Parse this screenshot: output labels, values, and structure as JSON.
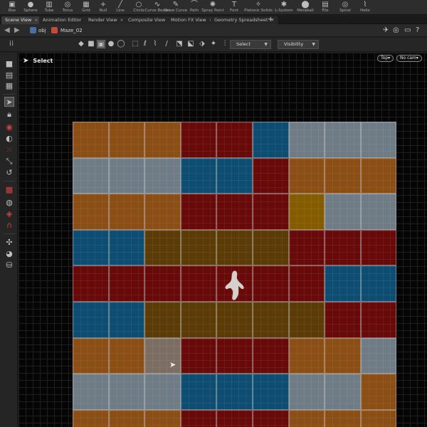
{
  "shelf": {
    "tools": [
      {
        "label": "Box",
        "icon": "box-icon"
      },
      {
        "label": "Sphere",
        "icon": "sphere-icon"
      },
      {
        "label": "Tube",
        "icon": "tube-icon"
      },
      {
        "label": "Torus",
        "icon": "torus-icon"
      },
      {
        "label": "Grid",
        "icon": "grid-icon"
      },
      {
        "label": "Null",
        "icon": "null-icon"
      },
      {
        "label": "Line",
        "icon": "line-icon"
      },
      {
        "label": "Circle",
        "icon": "circle-icon"
      },
      {
        "label": "Curve Bezier",
        "icon": "curve-bezier-icon"
      },
      {
        "label": "Draw Curve",
        "icon": "draw-curve-icon"
      },
      {
        "label": "Path",
        "icon": "path-icon"
      },
      {
        "label": "Spray Paint",
        "icon": "spray-paint-icon"
      },
      {
        "label": "Font",
        "icon": "font-icon"
      },
      {
        "label": "Platonic Solids",
        "icon": "platonic-solids-icon"
      },
      {
        "label": "L-System",
        "icon": "l-system-icon"
      },
      {
        "label": "Metaball",
        "icon": "metaball-icon"
      },
      {
        "label": "File",
        "icon": "file-icon"
      },
      {
        "label": "Spiral",
        "icon": "spiral-icon"
      },
      {
        "label": "Helix",
        "icon": "helix-icon"
      }
    ]
  },
  "tabs": [
    {
      "label": "Scene View",
      "active": true
    },
    {
      "label": "Animation Editor"
    },
    {
      "label": "Render View"
    },
    {
      "label": "Composite View"
    },
    {
      "label": "Motion FX View"
    },
    {
      "label": "Geometry Spreadsheet"
    }
  ],
  "tab_close": "×",
  "tab_add": "+",
  "path": {
    "root": "obj",
    "node": "Maze_02"
  },
  "toolbar": {
    "select_mode": "Select",
    "visibility": "Visibility"
  },
  "viewport": {
    "mode_label": "Select",
    "view_label": "Top",
    "camera_label": "No cam",
    "dropdown_marker": "▾"
  },
  "maze": {
    "rows": [
      [
        "o",
        "o",
        "o",
        "r",
        "r",
        "b",
        "g",
        "g",
        "g"
      ],
      [
        "g",
        "g",
        "g",
        "b",
        "b",
        "r",
        "o",
        "o",
        "o"
      ],
      [
        "o",
        "o",
        "o",
        "r",
        "r",
        "r",
        "Y",
        "g",
        "g"
      ],
      [
        "b",
        "b",
        "y",
        "y",
        "y",
        "y",
        "r",
        "r",
        "r"
      ],
      [
        "r",
        "r",
        "r",
        "r",
        "r",
        "r",
        "r",
        "b",
        "b"
      ],
      [
        "b",
        "b",
        "y",
        "y",
        "y",
        "y",
        "y",
        "r",
        "r"
      ],
      [
        "o",
        "o",
        "h",
        "r",
        "r",
        "r",
        "o",
        "o",
        "g"
      ],
      [
        "g",
        "g",
        "g",
        "b",
        "b",
        "b",
        "g",
        "g",
        "o"
      ],
      [
        "o",
        "o",
        "o",
        "r",
        "r",
        "r",
        "o",
        "o",
        "o"
      ]
    ],
    "colors": {
      "o": "#8b4e14",
      "r": "#680a0a",
      "b": "#0e4d72",
      "g": "#6f7c86",
      "y": "#5b3c07",
      "Y": "#855b00",
      "h": "#7b6d62"
    }
  },
  "colors": {
    "accent_crumb": "#c64a3a",
    "viewport_bg": "#050505"
  }
}
